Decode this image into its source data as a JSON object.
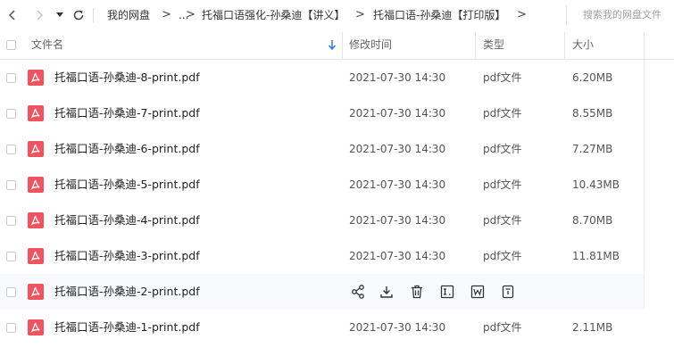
{
  "nav": {
    "breadcrumb": [
      "我的网盘",
      "...",
      "托福口语强化-孙桑迪【讲义】",
      "托福口语-孙桑迪【打印版】"
    ],
    "separator": ">",
    "search_placeholder": "搜索我的网盘文件"
  },
  "columns": {
    "name": "文件名",
    "modified": "修改时间",
    "type": "类型",
    "size": "大小"
  },
  "files": [
    {
      "name": "托福口语-孙桑迪-8-print.pdf",
      "modified": "2021-07-30 14:30",
      "type": "pdf文件",
      "size": "6.20MB"
    },
    {
      "name": "托福口语-孙桑迪-7-print.pdf",
      "modified": "2021-07-30 14:30",
      "type": "pdf文件",
      "size": "8.55MB"
    },
    {
      "name": "托福口语-孙桑迪-6-print.pdf",
      "modified": "2021-07-30 14:30",
      "type": "pdf文件",
      "size": "7.27MB"
    },
    {
      "name": "托福口语-孙桑迪-5-print.pdf",
      "modified": "2021-07-30 14:30",
      "type": "pdf文件",
      "size": "10.43MB"
    },
    {
      "name": "托福口语-孙桑迪-4-print.pdf",
      "modified": "2021-07-30 14:30",
      "type": "pdf文件",
      "size": "8.70MB"
    },
    {
      "name": "托福口语-孙桑迪-3-print.pdf",
      "modified": "2021-07-30 14:30",
      "type": "pdf文件",
      "size": "11.81MB"
    },
    {
      "name": "托福口语-孙桑迪-2-print.pdf",
      "modified": "",
      "type": "",
      "size": ""
    },
    {
      "name": "托福口语-孙桑迪-1-print.pdf",
      "modified": "2021-07-30 14:30",
      "type": "pdf文件",
      "size": "2.11MB"
    }
  ],
  "hover_actions": [
    "share-icon",
    "download-icon",
    "delete-icon",
    "text-extract-icon",
    "word-convert-icon",
    "more-icon"
  ],
  "colors": {
    "pdf": "#f0525e",
    "sort_arrow": "#2b7de9"
  }
}
